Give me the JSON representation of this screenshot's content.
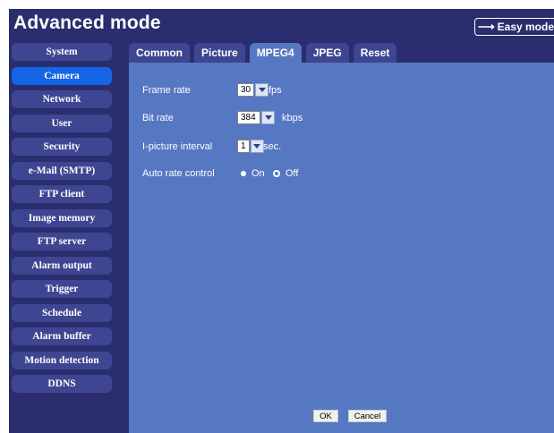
{
  "app": {
    "title": "Advanced mode",
    "easy_mode_label": "Easy mode"
  },
  "sidebar": {
    "items": [
      {
        "label": "System"
      },
      {
        "label": "Camera"
      },
      {
        "label": "Network"
      },
      {
        "label": "User"
      },
      {
        "label": "Security"
      },
      {
        "label": "e-Mail (SMTP)"
      },
      {
        "label": "FTP client"
      },
      {
        "label": "Image memory"
      },
      {
        "label": "FTP server"
      },
      {
        "label": "Alarm output"
      },
      {
        "label": "Trigger"
      },
      {
        "label": "Schedule"
      },
      {
        "label": "Alarm buffer"
      },
      {
        "label": "Motion detection"
      },
      {
        "label": "DDNS"
      }
    ],
    "active": "Camera"
  },
  "tabs": {
    "items": [
      {
        "label": "Common"
      },
      {
        "label": "Picture"
      },
      {
        "label": "MPEG4"
      },
      {
        "label": "JPEG"
      },
      {
        "label": "Reset"
      }
    ],
    "active": "MPEG4"
  },
  "form": {
    "frame_rate": {
      "label": "Frame rate",
      "value": "30",
      "unit": "fps"
    },
    "bit_rate": {
      "label": "Bit rate",
      "value": "384",
      "unit": "kbps"
    },
    "i_picture_interval": {
      "label": "I-picture interval",
      "value": "1",
      "unit": "sec."
    },
    "auto_rate_control": {
      "label": "Auto rate control",
      "options": [
        "On",
        "Off"
      ],
      "selected": "Off"
    }
  },
  "buttons": {
    "ok": "OK",
    "cancel": "Cancel"
  },
  "colors": {
    "app_bg": "#2a2e6e",
    "panel_bg": "#5677c2",
    "nav_bg": "#3e4691",
    "nav_active": "#1565e6"
  }
}
